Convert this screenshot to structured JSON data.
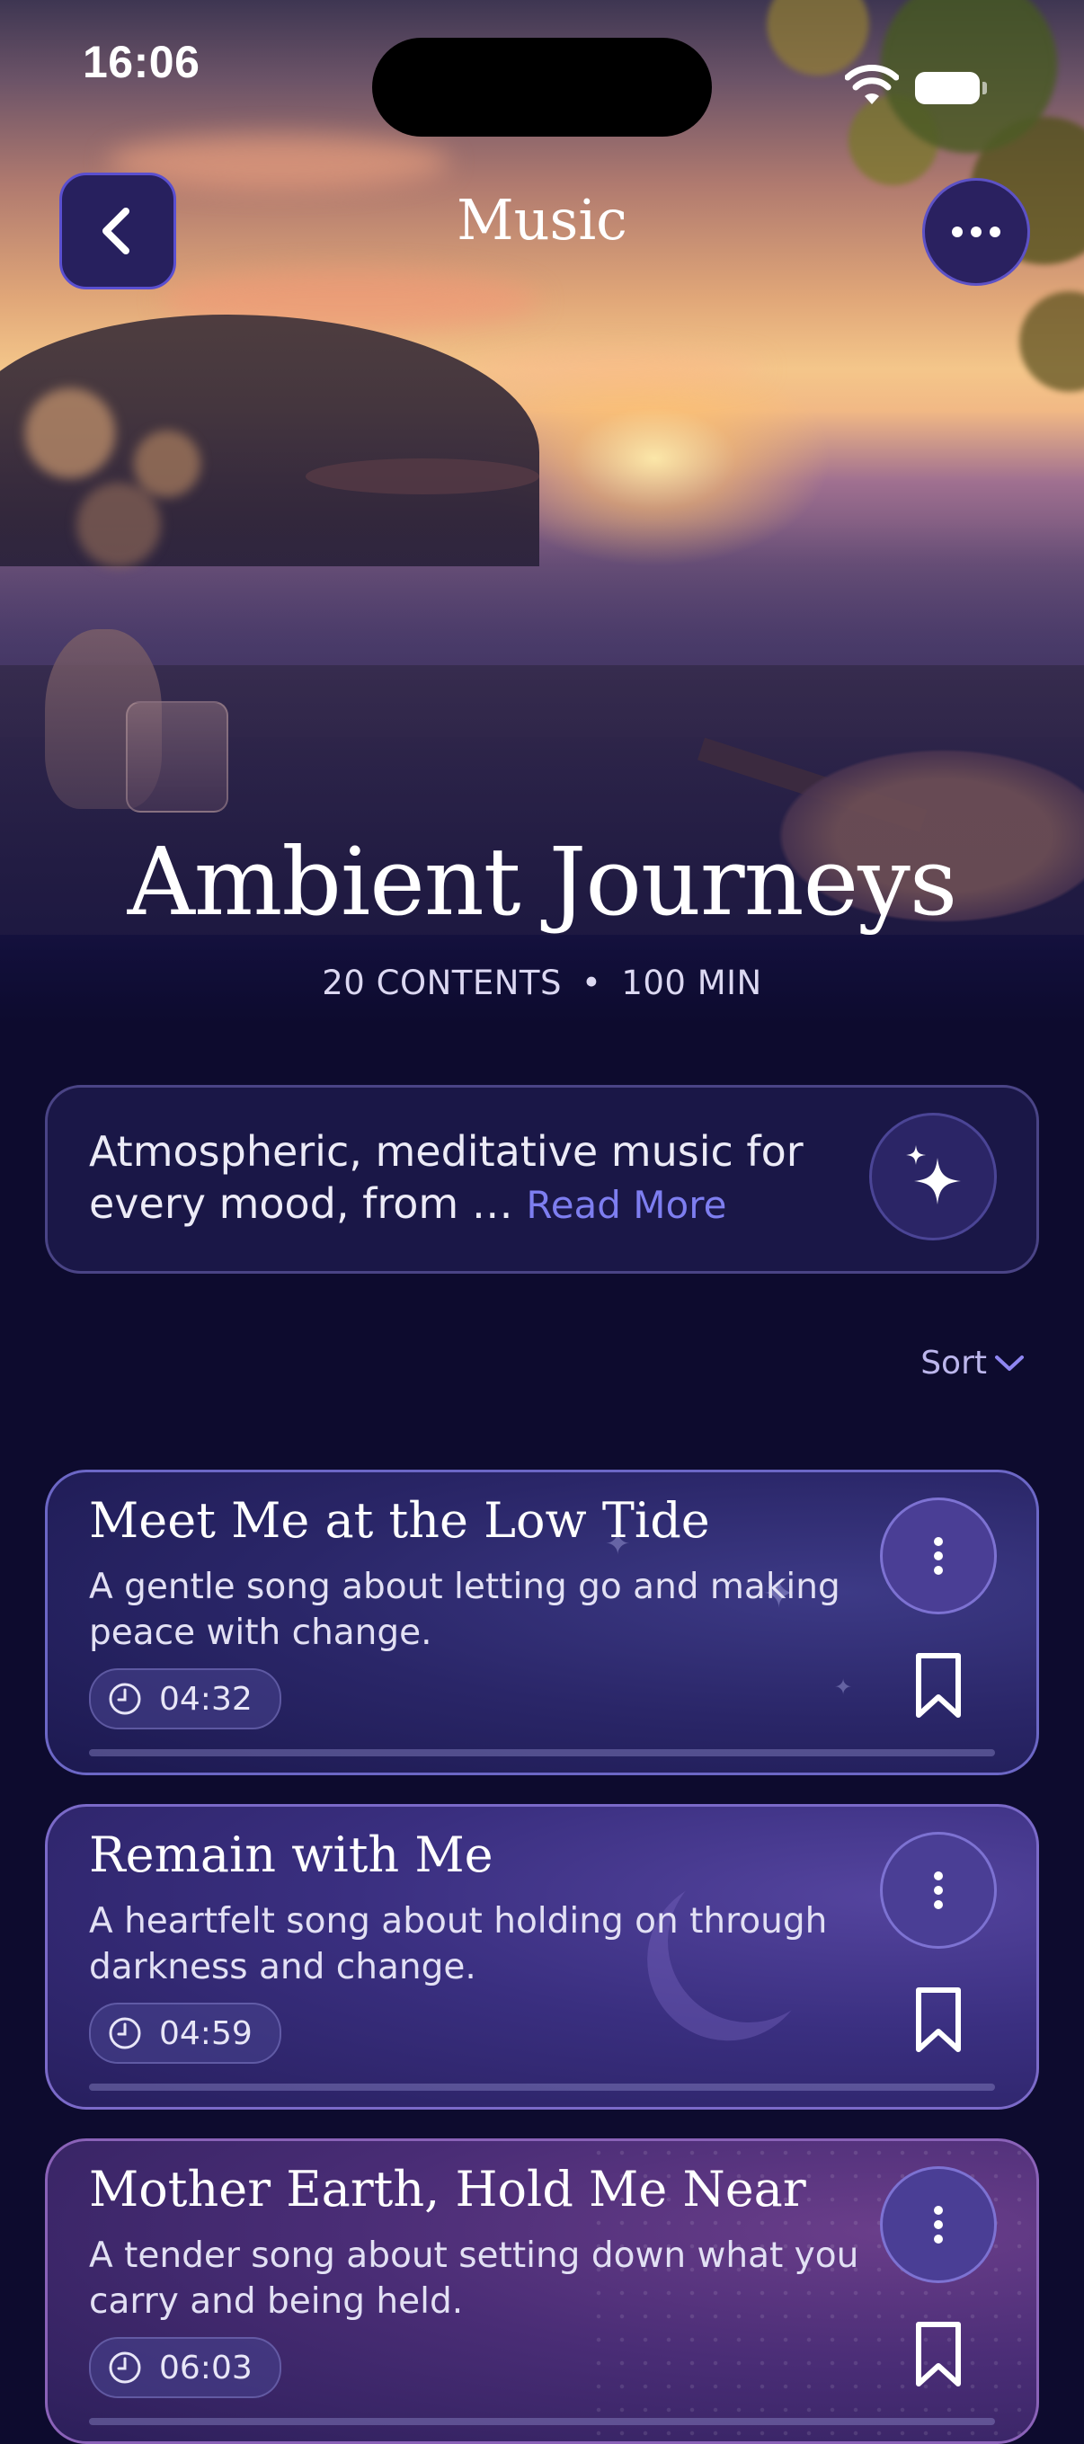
{
  "status_bar": {
    "time": "16:06"
  },
  "nav": {
    "title": "Music",
    "back_icon": "chevron-left-icon",
    "more_icon": "ellipsis-icon"
  },
  "album": {
    "title": "Ambient Journeys",
    "contents": "20 CONTENTS",
    "separator": "•",
    "duration": "100 MIN"
  },
  "description": {
    "text": "Atmospheric, meditative music for every mood, from …",
    "read_more": "Read More",
    "action_icon": "sparkles-icon"
  },
  "sort": {
    "label": "Sort"
  },
  "tracks": [
    {
      "title": "Meet Me at the Low Tide",
      "description": "A gentle song about letting go and making peace with change.",
      "duration": "04:32"
    },
    {
      "title": "Remain with Me",
      "description": "A heartfelt song about holding on through darkness and change.",
      "duration": "04:59"
    },
    {
      "title": "Mother Earth, Hold Me Near",
      "description": "A tender song about setting down what you carry and being held.",
      "duration": "06:03"
    }
  ],
  "colors": {
    "background": "#0d0b2e",
    "accent": "#7e7ef0",
    "card_border": "#6c67c6"
  }
}
